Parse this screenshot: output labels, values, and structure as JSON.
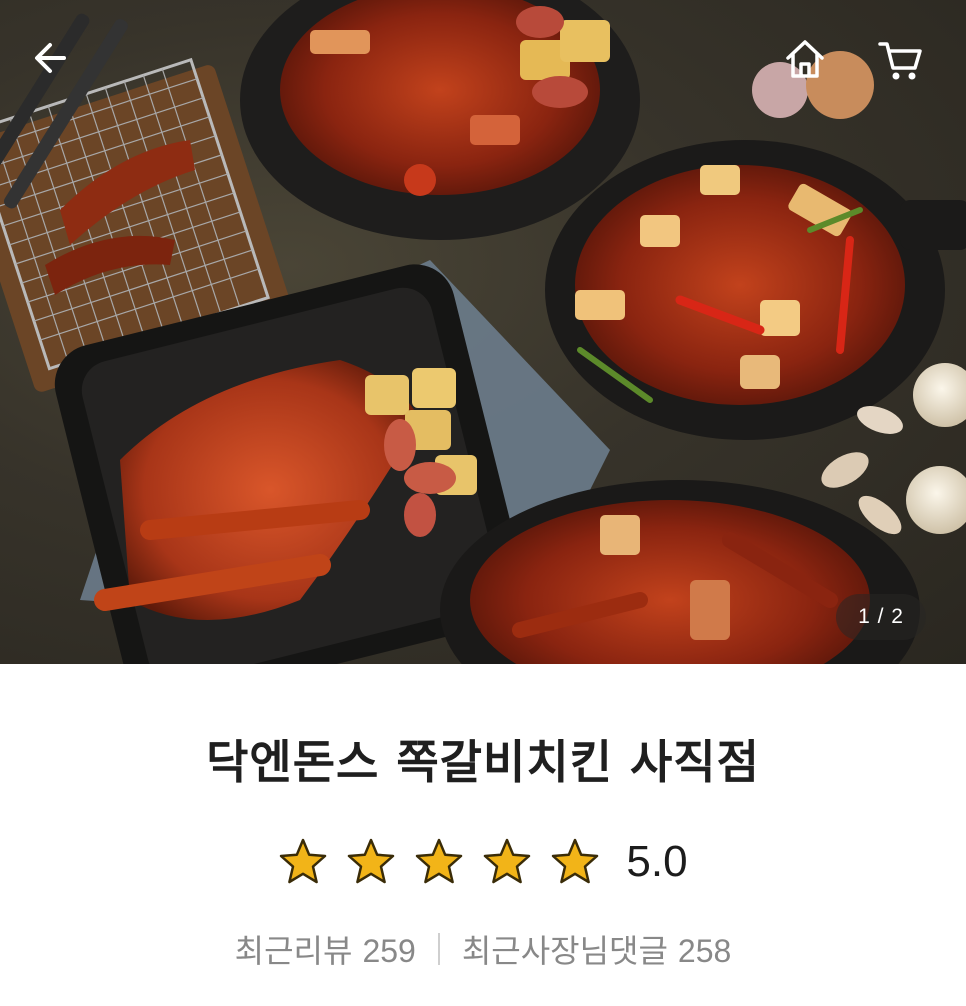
{
  "hero": {
    "pager_text": "1 / 2",
    "image_icon": "food-photo"
  },
  "topbar": {
    "back_icon": "arrow-left-icon",
    "home_icon": "home-icon",
    "cart_icon": "cart-icon"
  },
  "store": {
    "name": "닥엔돈스 쪽갈비치킨 사직점",
    "rating": 5.0,
    "rating_text": "5.0",
    "star_count": 5,
    "star_color": "#f2b418"
  },
  "counts": {
    "review_label": "최근리뷰",
    "review_count": "259",
    "owner_reply_label": "최근사장님댓글",
    "owner_reply_count": "258"
  }
}
